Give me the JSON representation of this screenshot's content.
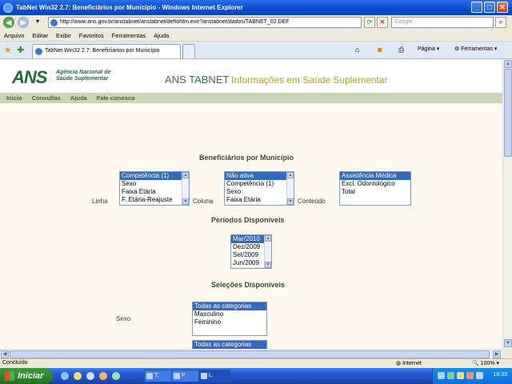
{
  "window": {
    "title": "TabNet Win32 2.7: Beneficiários por Município - Windows Internet Explorer",
    "minimize": "_",
    "maximize": "□",
    "close": "✕"
  },
  "address": {
    "url": "http://www.ans.gov.br/anstabnet/anstabnet/deftohtm.exe?anstabnet/dados/TABNET_02.DEF",
    "search_placeholder": "Google"
  },
  "menu": [
    "Arquivo",
    "Editar",
    "Exibir",
    "Favoritos",
    "Ferramentas",
    "Ajuda"
  ],
  "tab": {
    "title": "TabNet Win32 2.7: Beneficiários por Município"
  },
  "toolbar": {
    "page": "Página",
    "tools": "Ferramentas"
  },
  "site": {
    "logo": "ANS",
    "logo_line1": "Agência Nacional de",
    "logo_line2": "Saúde Suplementar",
    "brand": "ANS TABNET",
    "tagline": "Informações em Saúde Suplementar",
    "nav": [
      "Início",
      "Consultas",
      "Ajuda",
      "Fale conosco"
    ]
  },
  "form": {
    "heading": "Beneficiários por Município",
    "linha_label": "Linha",
    "coluna_label": "Coluna",
    "conteudo_label": "Conteúdo",
    "linha_options": [
      "Competência (1)",
      "Sexo",
      "Faixa Etária",
      "F. Etária-Reajuste"
    ],
    "coluna_options": [
      "Não ativa",
      "Competência (1)",
      "Sexo",
      "Faixa Etária"
    ],
    "conteudo_options": [
      "Assistência Médica",
      "Excl. Odontológico",
      "Total"
    ],
    "periodos_heading": "Períodos Disponíveis",
    "periodos_options": [
      "Mar/2010",
      "Dez/2009",
      "Set/2009",
      "Jun/2009"
    ],
    "selecoes_heading": "Seleções Disponíveis",
    "sexo_label": "Sexo",
    "sexo_options": [
      "Todas as categorias",
      "Masculino",
      "Feminino"
    ],
    "next_options": [
      "Todas as categorias"
    ]
  },
  "status": {
    "text": "Concluído",
    "zone": "Internet",
    "zoom": "100%"
  },
  "taskbar": {
    "start": "Iniciar",
    "tasks": [
      "T.",
      "P.",
      "L."
    ],
    "clock": "18:33"
  },
  "colors": {
    "selection": "#316ac5",
    "site_green": "#2a7a3f",
    "site_gold": "#b5a21a",
    "nav_bg": "#cbd5b4"
  }
}
